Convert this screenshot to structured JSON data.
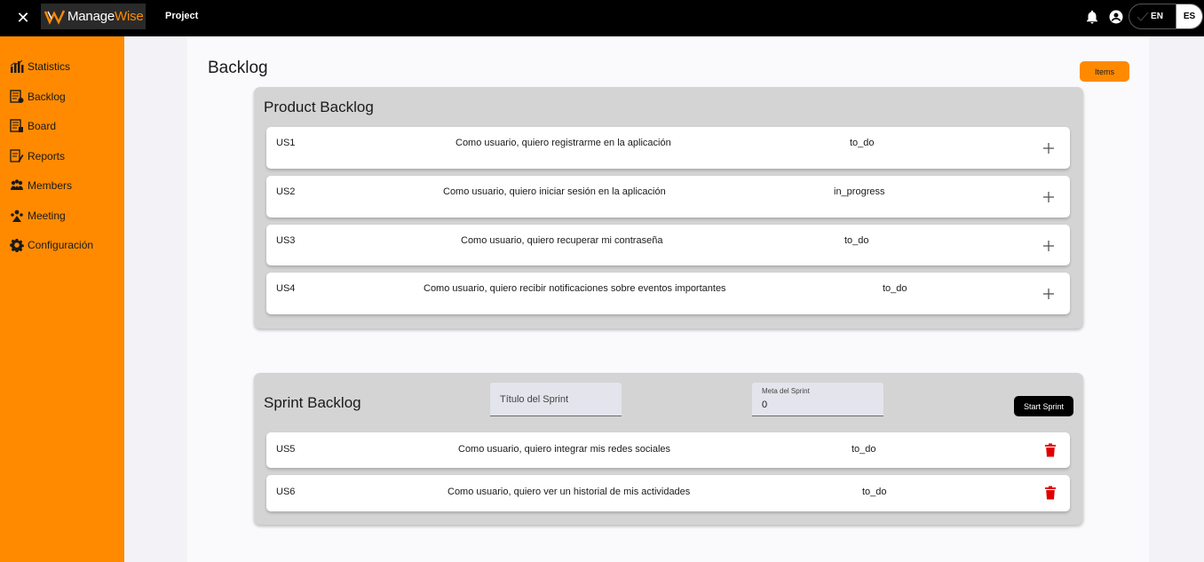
{
  "topbar": {
    "close_icon": "close-icon",
    "logo_text_main": "Manage",
    "logo_text_accent": "Wise",
    "project_label": "Project",
    "lang_en": "EN",
    "lang_es": "ES"
  },
  "sidebar": {
    "items": [
      {
        "label": "Statistics",
        "icon": "bar-chart-icon"
      },
      {
        "label": "Backlog",
        "icon": "backlog-icon"
      },
      {
        "label": "Board",
        "icon": "board-icon"
      },
      {
        "label": "Reports",
        "icon": "reports-icon"
      },
      {
        "label": "Members",
        "icon": "members-icon"
      },
      {
        "label": "Meeting",
        "icon": "meeting-icon"
      },
      {
        "label": "Configuración",
        "icon": "gear-icon"
      }
    ]
  },
  "page": {
    "title": "Backlog",
    "items_button": "Items"
  },
  "product_backlog": {
    "title": "Product Backlog",
    "rows": [
      {
        "id": "US1",
        "description": "Como usuario, quiero registrarme en la aplicación",
        "status": "to_do"
      },
      {
        "id": "US2",
        "description": "Como usuario, quiero iniciar sesión en la aplicación",
        "status": "in_progress"
      },
      {
        "id": "US3",
        "description": "Como usuario, quiero recuperar mi contraseña",
        "status": "to_do"
      },
      {
        "id": "US4",
        "description": "Como usuario, quiero recibir notificaciones sobre eventos importantes",
        "status": "to_do"
      }
    ]
  },
  "sprint_backlog": {
    "title": "Sprint Backlog",
    "sprint_title_placeholder": "Título del Sprint",
    "sprint_goal_label": "Meta del Sprint",
    "sprint_goal_value": "0",
    "start_button": "Start Sprint",
    "rows": [
      {
        "id": "US5",
        "description": "Como usuario, quiero integrar mis redes sociales",
        "status": "to_do"
      },
      {
        "id": "US6",
        "description": "Como usuario, quiero ver un historial de mis actividades",
        "status": "to_do"
      }
    ]
  },
  "colors": {
    "accent": "#ff8a00",
    "topbar": "#000000",
    "delete": "#e00000"
  }
}
